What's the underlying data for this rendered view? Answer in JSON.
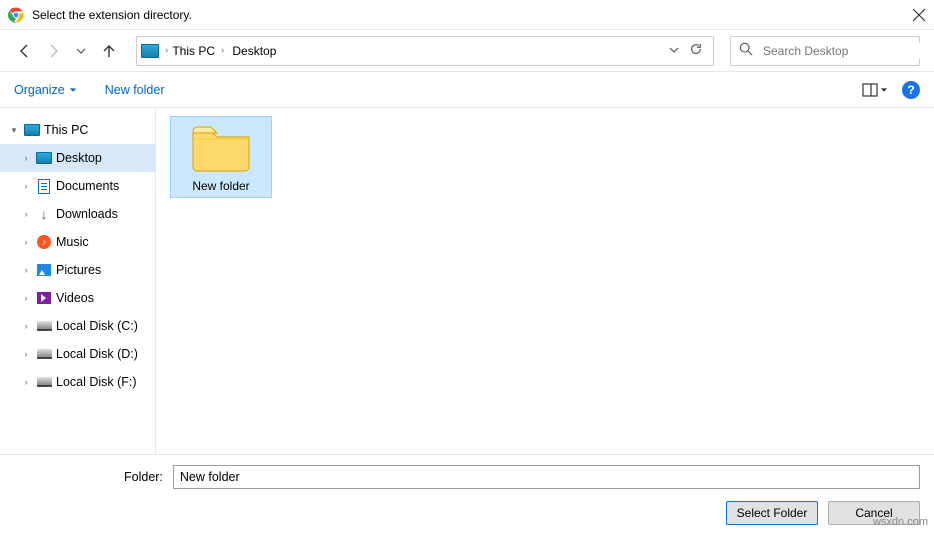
{
  "window": {
    "title": "Select the extension directory."
  },
  "nav": {
    "history_dropdown": "▾"
  },
  "breadcrumbs": {
    "root": "This PC",
    "current": "Desktop"
  },
  "search": {
    "placeholder": "Search Desktop"
  },
  "cmdbar": {
    "organize": "Organize",
    "new_folder": "New folder"
  },
  "tree": {
    "root": "This PC",
    "items": [
      {
        "label": "Desktop",
        "icon": "monitor",
        "selected": true
      },
      {
        "label": "Documents",
        "icon": "doc",
        "selected": false
      },
      {
        "label": "Downloads",
        "icon": "down",
        "selected": false
      },
      {
        "label": "Music",
        "icon": "music",
        "selected": false
      },
      {
        "label": "Pictures",
        "icon": "pic",
        "selected": false
      },
      {
        "label": "Videos",
        "icon": "vid",
        "selected": false
      },
      {
        "label": "Local Disk (C:)",
        "icon": "disk",
        "selected": false
      },
      {
        "label": "Local Disk (D:)",
        "icon": "disk",
        "selected": false
      },
      {
        "label": "Local Disk (F:)",
        "icon": "disk",
        "selected": false
      }
    ]
  },
  "content": {
    "items": [
      {
        "name": "New folder",
        "type": "folder",
        "selected": true
      }
    ]
  },
  "footer": {
    "folder_label": "Folder:",
    "folder_value": "New folder",
    "select_button": "Select Folder",
    "cancel_button": "Cancel"
  },
  "watermark": "wsxdn.com"
}
